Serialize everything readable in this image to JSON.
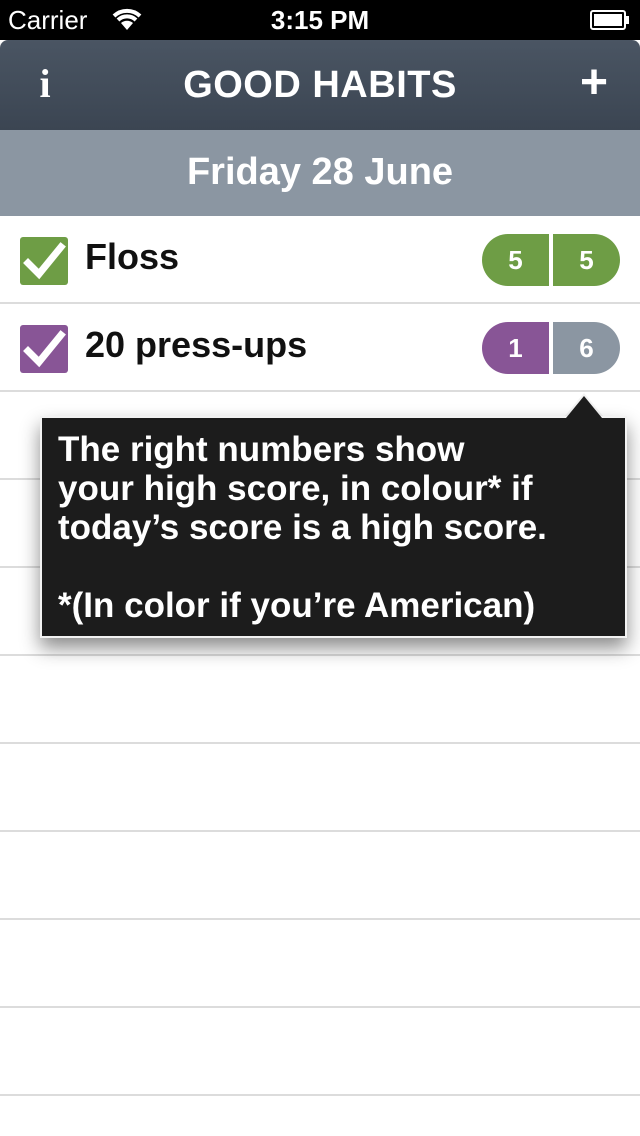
{
  "status_bar": {
    "carrier": "Carrier",
    "time": "3:15 PM",
    "wifi_icon": "wifi-icon",
    "battery_icon": "battery-icon"
  },
  "nav": {
    "title": "GOOD HABITS",
    "info_label": "i",
    "add_label": "+"
  },
  "date_header": "Friday 28 June",
  "habits": [
    {
      "name": "Floss",
      "checked": true,
      "color": "#6e9d45",
      "today_score": "5",
      "high_score": "5",
      "high_score_color": "#6e9d45"
    },
    {
      "name": "20 press-ups",
      "checked": true,
      "color": "#885596",
      "today_score": "1",
      "high_score": "6",
      "high_score_color": "#8b96a2"
    }
  ],
  "tooltip": {
    "line1": "The right numbers show",
    "line2": "your high score, in colour* if",
    "line3": "today’s score is a high score.",
    "line4": "*(In color if  you’re American)"
  }
}
